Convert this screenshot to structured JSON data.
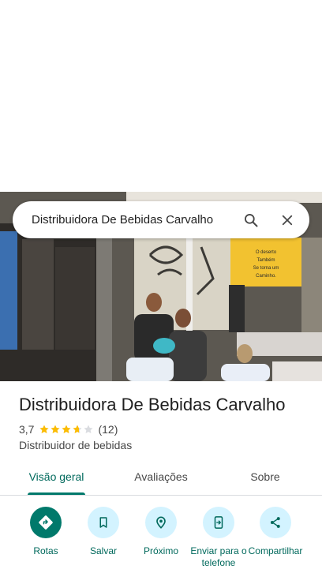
{
  "search": {
    "query": "Distribuidora De Bebidas Carvalho"
  },
  "place": {
    "name": "Distribuidora De Bebidas Carvalho",
    "rating": "3,7",
    "rating_value": 3.7,
    "rating_max": 5,
    "review_count": "(12)",
    "category": "Distribuidor de bebidas"
  },
  "tabs": [
    {
      "label": "Visão geral",
      "active": true
    },
    {
      "label": "Avaliações",
      "active": false
    },
    {
      "label": "Sobre",
      "active": false
    }
  ],
  "actions": [
    {
      "label": "Rotas",
      "icon": "directions-icon"
    },
    {
      "label": "Salvar",
      "icon": "bookmark-icon"
    },
    {
      "label": "Próximo",
      "icon": "nearby-icon"
    },
    {
      "label": "Enviar para o telefone",
      "icon": "send-to-phone-icon"
    },
    {
      "label": "Compartilhar",
      "icon": "share-icon"
    }
  ],
  "photo": {
    "wall_text": "O deserto Também Se torna um Caminho."
  },
  "colors": {
    "accent": "#00796b",
    "accent_text": "#00695c",
    "action_bg": "#d3f3ff",
    "star": "#fbbc04"
  }
}
